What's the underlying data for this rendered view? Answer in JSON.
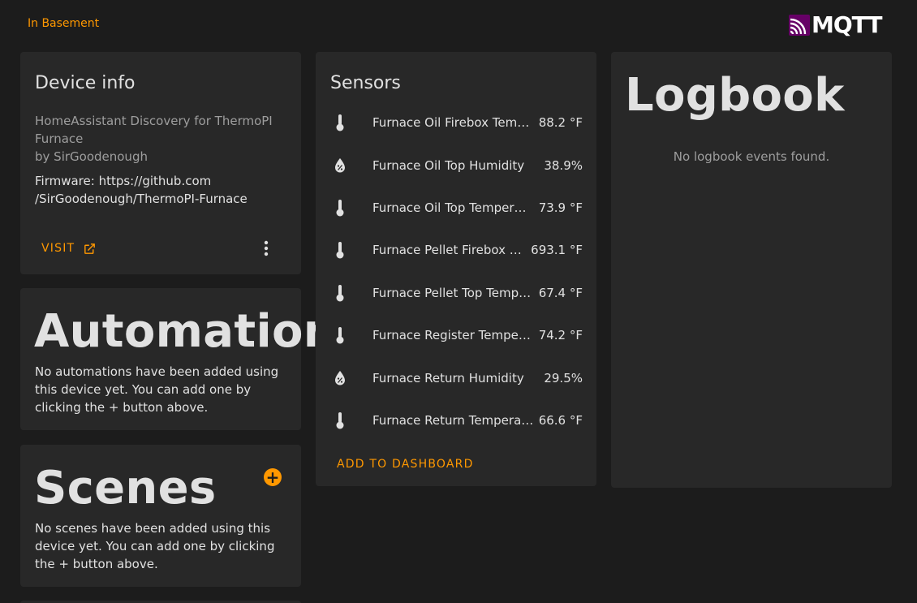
{
  "header": {
    "area_link": "In Basement",
    "brand": "MQTT"
  },
  "device_info": {
    "title": "Device info",
    "description": "HomeAssistant Discovery for ThermoPI Furnace",
    "by": "by SirGoodenough",
    "firmware_line1": "Firmware: https://github.com",
    "firmware_line2": "/SirGoodenough/ThermoPI-Furnace",
    "visit_label": "VISIT"
  },
  "automations": {
    "title": "Automations",
    "empty_text": "No automations have been added using this device yet. You can add one by clicking the + button above."
  },
  "scenes": {
    "title": "Scenes",
    "add_label": "+",
    "empty_text": "No scenes have been added using this device yet. You can add one by clicking the + button above."
  },
  "sensors": {
    "title": "Sensors",
    "items": [
      {
        "icon": "thermometer-icon",
        "name": "Furnace Oil Firebox Temperature",
        "value": "88.2 °F"
      },
      {
        "icon": "water-percent-icon",
        "name": "Furnace Oil Top Humidity",
        "value": "38.9%"
      },
      {
        "icon": "thermometer-icon",
        "name": "Furnace Oil Top Temperature",
        "value": "73.9 °F"
      },
      {
        "icon": "thermometer-icon",
        "name": "Furnace Pellet Firebox Temperature",
        "value": "693.1 °F"
      },
      {
        "icon": "thermometer-icon",
        "name": "Furnace Pellet Top Temperature",
        "value": "67.4 °F"
      },
      {
        "icon": "thermometer-icon",
        "name": "Furnace Register Temperature",
        "value": "74.2 °F"
      },
      {
        "icon": "water-percent-icon",
        "name": "Furnace Return Humidity",
        "value": "29.5%"
      },
      {
        "icon": "thermometer-icon",
        "name": "Furnace Return Temperature",
        "value": "66.6 °F"
      }
    ],
    "add_to_dashboard_label": "ADD TO DASHBOARD"
  },
  "logbook": {
    "title": "Logbook",
    "empty_text": "No logbook events found."
  },
  "colors": {
    "background": "#1c1c1c",
    "card": "#282828",
    "accent": "#ff9800",
    "brand_purple": "#660066"
  }
}
